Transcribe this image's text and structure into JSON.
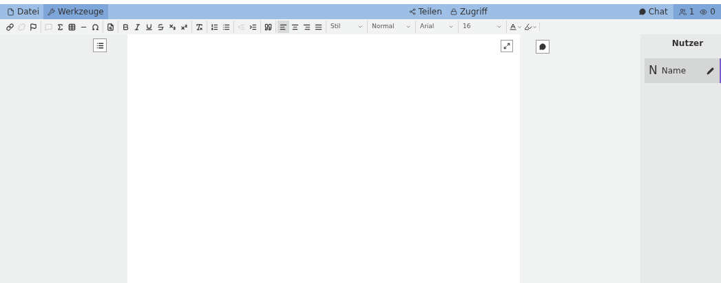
{
  "menu": [
    {
      "label": "Datei",
      "selected": false
    },
    {
      "label": "Werkzeuge",
      "selected": true
    }
  ],
  "share": {
    "teilen": "Teilen",
    "zugriff": "Zugriff"
  },
  "status": {
    "chat": "Chat",
    "users": "1",
    "viewers": "0"
  },
  "toolbar": {
    "groups": [
      [
        {
          "disabled": false
        },
        {
          "disabled": true
        },
        {
          "disabled": false
        }
      ],
      [
        {
          "disabled": true
        },
        {
          "disabled": false
        },
        {
          "disabled": false
        },
        {
          "disabled": false
        },
        {
          "disabled": false
        }
      ],
      [
        {
          "disabled": false
        }
      ],
      [
        {
          "disabled": false
        },
        {
          "disabled": false
        },
        {
          "disabled": false
        },
        {
          "disabled": false
        },
        {
          "disabled": false
        },
        {
          "disabled": false
        }
      ],
      [
        {
          "disabled": false
        }
      ],
      [
        {
          "disabled": false
        },
        {
          "disabled": false
        }
      ],
      [
        {
          "disabled": true
        },
        {
          "disabled": false
        }
      ],
      [
        {
          "disabled": false
        }
      ],
      [
        {
          "disabled": false,
          "selected": true
        },
        {
          "disabled": false,
          "selected": false
        },
        {
          "disabled": false,
          "selected": false
        },
        {
          "disabled": false,
          "selected": false
        }
      ]
    ],
    "dropdowns": [
      {
        "value": "Stil"
      },
      {
        "value": "Normal"
      },
      {
        "value": "Arial"
      },
      {
        "value": "16"
      }
    ]
  },
  "sidebar": {
    "title": "Nutzer",
    "users": [
      {
        "initial": "N",
        "name": "Name"
      }
    ]
  }
}
